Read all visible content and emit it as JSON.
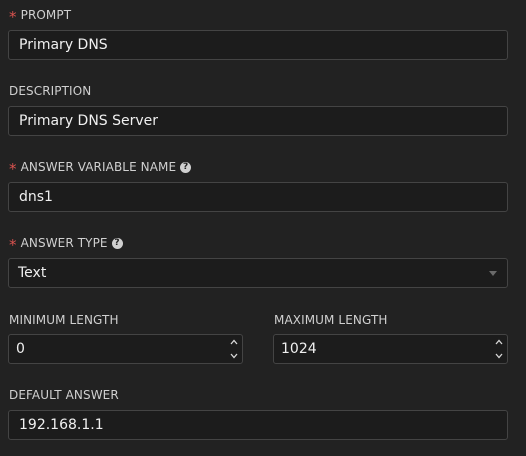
{
  "fields": {
    "prompt": {
      "label": "PROMPT",
      "value": "Primary DNS",
      "required": true
    },
    "description": {
      "label": "DESCRIPTION",
      "value": "Primary DNS Server"
    },
    "answer_variable_name": {
      "label": "ANSWER VARIABLE NAME",
      "value": "dns1",
      "required": true,
      "help_icon": "question-circle-icon"
    },
    "answer_type": {
      "label": "ANSWER TYPE",
      "value": "Text",
      "required": true,
      "help_icon": "question-circle-icon"
    },
    "minimum_length": {
      "label": "MINIMUM LENGTH",
      "value": "0"
    },
    "maximum_length": {
      "label": "MAXIMUM LENGTH",
      "value": "1024"
    },
    "default_answer": {
      "label": "DEFAULT ANSWER",
      "value": "192.168.1.1"
    }
  },
  "colors": {
    "background": "#222222",
    "input_background": "#1c1c1c",
    "input_border": "#444444",
    "required_asterisk": "#d9534f",
    "label_text": "#d0d0d0"
  }
}
